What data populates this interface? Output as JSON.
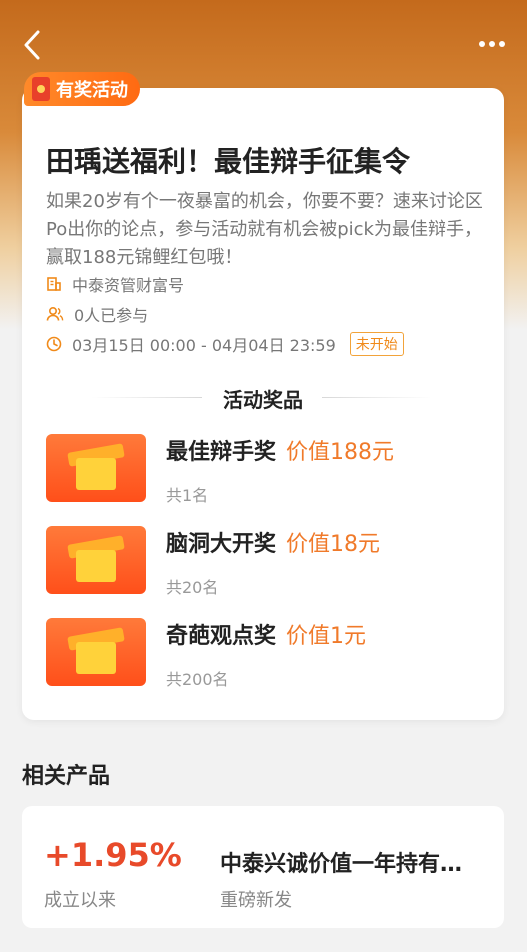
{
  "header": {
    "back_icon": "chevron-left-icon",
    "more_icon": "more-dots-icon"
  },
  "activity": {
    "tag": "有奖活动",
    "title": "田瑀送福利！最佳辩手征集令",
    "description": "如果20岁有个一夜暴富的机会，你要不要？速来讨论区Po出你的论点，参与活动就有机会被pick为最佳辩手，赢取188元锦鲤红包哦！",
    "organizer": "中泰资管财富号",
    "participants": "0人已参与",
    "time_range": "03月15日 00:00 - 04月04日 23:59",
    "status": "未开始"
  },
  "prizes": {
    "section_title": "活动奖品",
    "items": [
      {
        "name": "最佳辩手奖",
        "value": "价值188元",
        "count": "共1名"
      },
      {
        "name": "脑洞大开奖",
        "value": "价值18元",
        "count": "共20名"
      },
      {
        "name": "奇葩观点奖",
        "value": "价值1元",
        "count": "共200名"
      }
    ]
  },
  "related": {
    "title": "相关产品",
    "product": {
      "rate": "+1.95%",
      "rate_label": "成立以来",
      "name": "中泰兴诚价值一年持有…",
      "subtitle": "重磅新发"
    }
  },
  "colors": {
    "accent_orange": "#f07a2a",
    "rate_red": "#e84a2a",
    "tag_orange": "#ff7a1a"
  }
}
